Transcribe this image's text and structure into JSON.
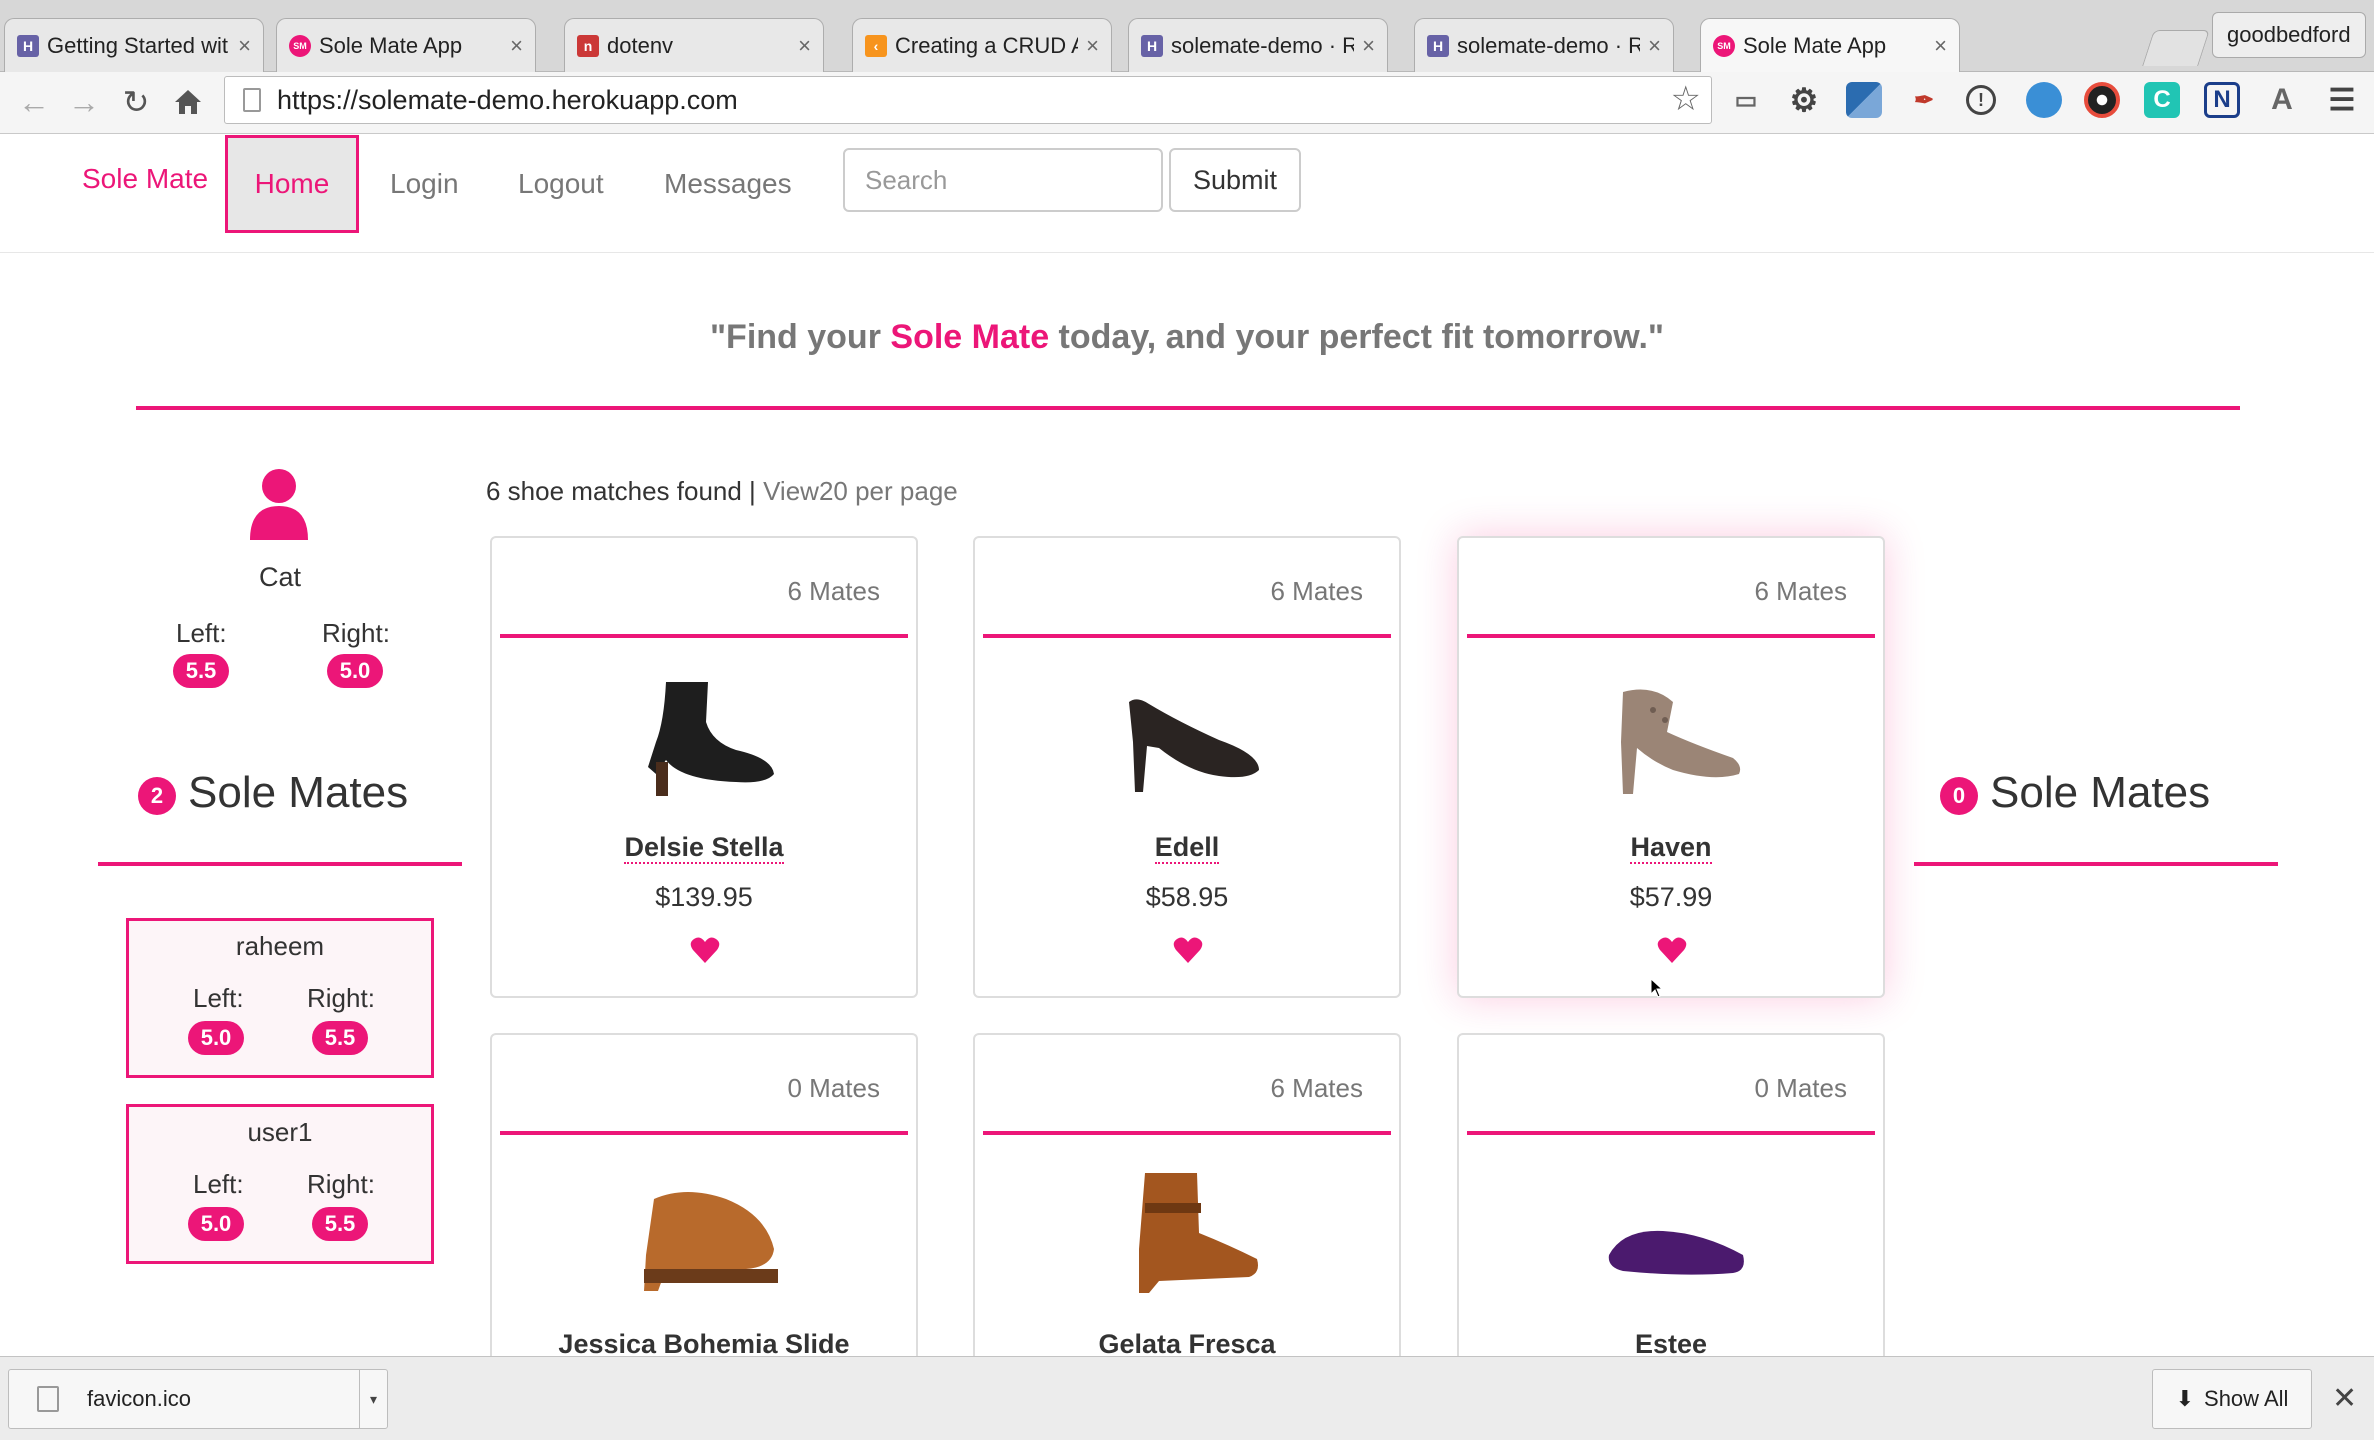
{
  "browser": {
    "tabs": [
      {
        "title": "Getting Started wit",
        "favicon": "heroku-icon",
        "color": "#6762a6",
        "glyph": "H",
        "active": false
      },
      {
        "title": "Sole Mate App",
        "favicon": "solemate-icon",
        "color": "#ec1678",
        "glyph": "SM",
        "active": false
      },
      {
        "title": "dotenv",
        "favicon": "npm-icon",
        "color": "#cb3837",
        "glyph": "n",
        "active": false
      },
      {
        "title": "Creating a CRUD A",
        "favicon": "sitepoint-icon",
        "color": "#f7941d",
        "glyph": "‹",
        "active": false
      },
      {
        "title": "solemate-demo · R",
        "favicon": "heroku-icon",
        "color": "#6762a6",
        "glyph": "H",
        "active": false
      },
      {
        "title": "solemate-demo · R",
        "favicon": "heroku-icon",
        "color": "#6762a6",
        "glyph": "H",
        "active": false
      },
      {
        "title": "Sole Mate App",
        "favicon": "solemate-icon",
        "color": "#ec1678",
        "glyph": "SM",
        "active": true
      }
    ],
    "profile": "goodbedford",
    "url": "https://solemate-demo.herokuapp.com"
  },
  "nav": {
    "brand": "Sole Mate",
    "links": [
      {
        "label": "Home",
        "active": true
      },
      {
        "label": "Login",
        "active": false
      },
      {
        "label": "Logout",
        "active": false
      },
      {
        "label": "Messages",
        "active": false
      }
    ],
    "search_placeholder": "Search",
    "submit_label": "Submit"
  },
  "tagline": {
    "before": "\"Find your ",
    "highlight": "Sole Mate",
    "after": " today, and your perfect fit tomorrow.\""
  },
  "profile_user": {
    "name": "Cat",
    "left_label": "Left:",
    "right_label": "Right:",
    "left_size": "5.5",
    "right_size": "5.0"
  },
  "sole_mates_left": {
    "count": "2",
    "title": "Sole Mates",
    "mates": [
      {
        "name": "raheem",
        "left_label": "Left:",
        "right_label": "Right:",
        "left_size": "5.0",
        "right_size": "5.5"
      },
      {
        "name": "user1",
        "left_label": "Left:",
        "right_label": "Right:",
        "left_size": "5.0",
        "right_size": "5.5"
      }
    ]
  },
  "sole_mates_right": {
    "count": "0",
    "title": "Sole Mates"
  },
  "results": {
    "found_text": "6 shoe matches found |",
    "view_text": "View20 per page"
  },
  "shoes": [
    {
      "name": "Delsie Stella",
      "price": "$139.95",
      "mates": "6 Mates",
      "kind": "black-bootie",
      "color": "#1e1e1e"
    },
    {
      "name": "Edell",
      "price": "$58.95",
      "mates": "6 Mates",
      "kind": "black-pump",
      "color": "#2a2422"
    },
    {
      "name": "Haven",
      "price": "$57.99",
      "mates": "6 Mates",
      "kind": "taupe-slingback",
      "color": "#9b8576"
    },
    {
      "name": "Jessica Bohemia Slide",
      "price": "",
      "mates": "0 Mates",
      "kind": "tan-clog",
      "color": "#b86a2c"
    },
    {
      "name": "Gelata Fresca",
      "price": "",
      "mates": "6 Mates",
      "kind": "cognac-bootie",
      "color": "#a3561f"
    },
    {
      "name": "Estee",
      "price": "",
      "mates": "0 Mates",
      "kind": "purple-flat",
      "color": "#4b1a6e"
    }
  ],
  "downloads": {
    "file": "favicon.ico",
    "show_all": "Show All"
  },
  "colors": {
    "accent": "#ec1678",
    "muted": "#777777"
  }
}
